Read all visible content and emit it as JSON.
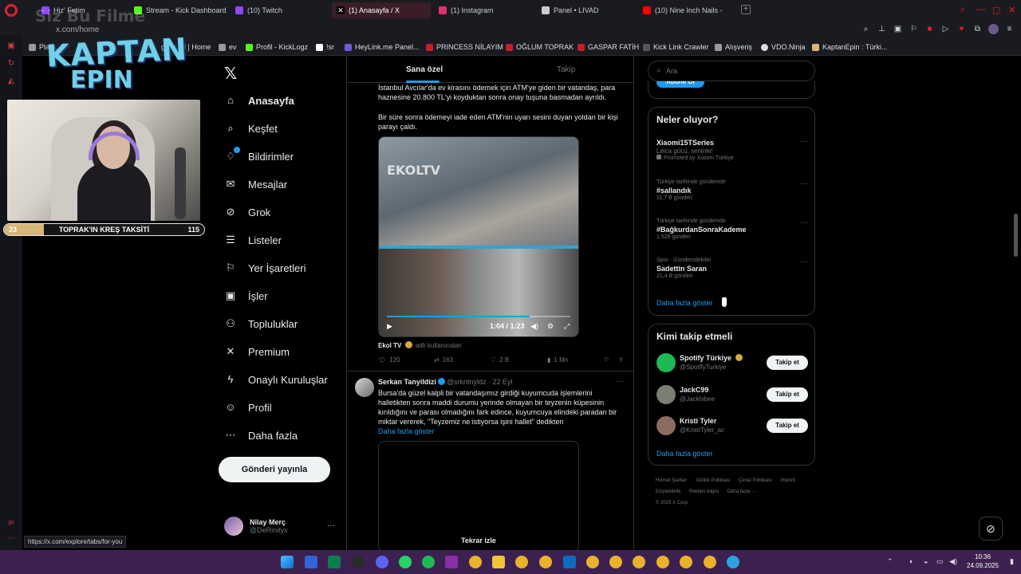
{
  "browser": {
    "tabs": [
      {
        "label": "Hiz' Fetim",
        "active": false,
        "color": "#9146ff"
      },
      {
        "label": "Stream - Kick Dashboard",
        "active": false,
        "color": "#53fc18"
      },
      {
        "label": "(10) Twitch",
        "active": false,
        "color": "#9146ff"
      },
      {
        "label": "(1) Anasayfa / X",
        "active": true,
        "color": "#ffffff"
      },
      {
        "label": "(1) Instagram",
        "active": false,
        "color": "#e1306c"
      },
      {
        "label": "Panel • LIVAD",
        "active": false,
        "color": "#cccccc"
      },
      {
        "label": "(10) Nine Inch Nails - ",
        "active": false,
        "color": "#ff0000"
      }
    ],
    "address": "x.com/home",
    "bookmarks": [
      "Plat...",
      "guns.lol | Home",
      "ev",
      "Profil - KickLogz",
      "!sr",
      "HeyLink.me Panel...",
      "PRINCESS NİLAYIM",
      "OĞLUM TOPRAK",
      "GASPAR FATİH",
      "Kick Link Crawler",
      "Alışveriş",
      "VDO.Ninja",
      "KaptanEpin : Türki..."
    ]
  },
  "stream": {
    "logo_line1": "KAPTAN",
    "logo_line2": "EPIN",
    "watermark": "Siz Bu Filme",
    "goal": {
      "current": "23",
      "label": "TOPRAK'IN KREŞ TAKSİTİ",
      "target": "115",
      "progress": 0.2
    }
  },
  "nav": {
    "items": [
      {
        "label": "Anasayfa",
        "icon": "home-icon",
        "glyph": "⌂"
      },
      {
        "label": "Keşfet",
        "icon": "search-icon",
        "glyph": "⌕"
      },
      {
        "label": "Bildirimler",
        "icon": "bell-icon",
        "glyph": "🔔"
      },
      {
        "label": "Mesajlar",
        "icon": "mail-icon",
        "glyph": "✉"
      },
      {
        "label": "Grok",
        "icon": "grok-icon",
        "glyph": "⊘"
      },
      {
        "label": "Listeler",
        "icon": "list-icon",
        "glyph": "☰"
      },
      {
        "label": "Yer İşaretleri",
        "icon": "bookmark-icon",
        "glyph": "⚐"
      },
      {
        "label": "İşler",
        "icon": "briefcase-icon",
        "glyph": "▣"
      },
      {
        "label": "Topluluklar",
        "icon": "people-icon",
        "glyph": "⚇"
      },
      {
        "label": "Premium",
        "icon": "x-logo-icon",
        "glyph": "✕"
      },
      {
        "label": "Onaylı Kuruluşlar",
        "icon": "lightning-icon",
        "glyph": "⚡"
      },
      {
        "label": "Profil",
        "icon": "profile-icon",
        "glyph": "☺"
      },
      {
        "label": "Daha fazla",
        "icon": "more-circle-icon",
        "glyph": "⋯"
      }
    ],
    "post_button": "Gönderi yayınla",
    "account": {
      "name": "Nilay Merç",
      "handle": "@DeRinityx"
    }
  },
  "feed": {
    "tabs": {
      "for_you": "Sana özel",
      "following": "Takip"
    },
    "tweet1": {
      "text1": "İstanbul Avcılar'da ev kirasını ödemek için ATM'ye giden bir vatandaş, para haznesine 20.800 TL'yi koyduktan sonra onay tuşuna basmadan ayrıldı.",
      "text2": "Bir süre sonra ödemeyi iade eden ATM'nin uyarı sesini duyan yoldan bir kişi parayı çaldı.",
      "video_time": "1:04 / 1:23",
      "video_progress": 0.78,
      "video_watermark": "EKOLTV",
      "source": "Ekol TV",
      "source_sub": "adlı kullanıcıdan",
      "replies": "120",
      "reposts": "163",
      "likes": "2 B",
      "views": "1 Mn"
    },
    "tweet2": {
      "name": "Serkan Tanyildizi",
      "handle": "@srkntnyldz · 22 Eyl",
      "text": "Bursa'da güzel kalpli bir vatandaşımız girdiği kuyumcuda işlemlerini halletikten sonra maddi durumu yerinde olmayan bir teyzenin küpesinin kırıldığını ve parası olmadığını fark edince, kuyumcuya elindeki paradan bir miktar vererek, \"Teyzemiz ne istiyorsa işini hallet\" dedikten",
      "show_more": "Daha fazla göster",
      "replay": "Tekrar izle"
    }
  },
  "right": {
    "search_placeholder": "Ara",
    "subscribe": "Abone Ol",
    "trends_title": "Neler oluyor?",
    "trends": [
      {
        "context": "",
        "name": "Xiaomi15TSeries",
        "desc": "Leica gücü, seninle!",
        "meta": "Promoted by Xiaomi Türkiye"
      },
      {
        "context": "Türkiye tarihinde gündemde",
        "name": "#sallandık",
        "desc": "",
        "meta": "11,7 B gönderi"
      },
      {
        "context": "Türkiye tarihinde gündemde",
        "name": "#BağkurdanSonraKademe",
        "desc": "",
        "meta": "1.528 gönderi"
      },
      {
        "context": "Spor · Gündemdekiler",
        "name": "Sadettin Saran",
        "desc": "",
        "meta": "21,4 B gönderi"
      }
    ],
    "trends_more": "Daha fazla göster",
    "who_title": "Kimi takip etmeli",
    "who": [
      {
        "name": "Spotify Türkiye",
        "handle": "@SpotifyTurkiye",
        "button": "Takip et",
        "color": "#1db954"
      },
      {
        "name": "JackC99",
        "handle": "@Jackhibee",
        "button": "Takip et",
        "color": "#7a7f73"
      },
      {
        "name": "Kristi Tyler",
        "handle": "@KristiTyler_ac",
        "button": "Takip et",
        "color": "#8a6d5e"
      }
    ],
    "who_more": "Daha fazla göster",
    "footer": [
      "Hizmet Şartları",
      "Gizlilik Politikası",
      "Çerez Politikası",
      "Imprint",
      "Erişilebilirlik",
      "Reklam bilgisi",
      "Daha fazla ···",
      "© 2025 X Corp."
    ]
  },
  "status_url": "https://x.com/explore/tabs/for-you",
  "clock": {
    "time": "10:36",
    "date": "24.09.2025"
  }
}
